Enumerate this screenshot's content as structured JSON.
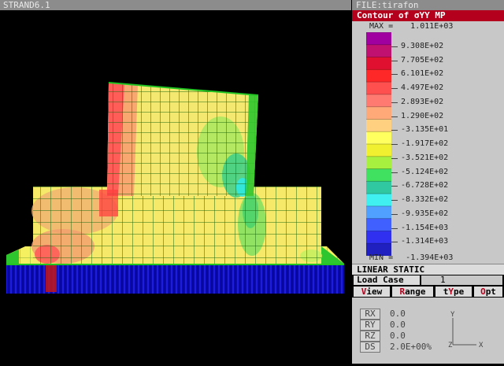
{
  "window": {
    "title": "STRAND6.1"
  },
  "file_bar": {
    "label": "FILE:tirafon"
  },
  "contour": {
    "title": "Contour of σYY MP",
    "max_label": "MAX =",
    "max_value": "1.011E+03",
    "min_label": "MIN =",
    "min_value": "-1.394E+03",
    "levels": [
      "9.308E+02",
      "7.705E+02",
      "6.101E+02",
      "4.497E+02",
      "2.893E+02",
      "1.290E+02",
      "-3.135E+01",
      "-1.917E+02",
      "-3.521E+02",
      "-5.124E+02",
      "-6.728E+02",
      "-8.332E+02",
      "-9.935E+02",
      "-1.154E+03",
      "-1.314E+03"
    ],
    "colors": [
      "#a000a0",
      "#c01070",
      "#e01030",
      "#ff2828",
      "#ff5050",
      "#ff7a70",
      "#ffa878",
      "#ffd080",
      "#ffff60",
      "#f0f030",
      "#a8f040",
      "#40e060",
      "#30c8a0",
      "#40f0f0",
      "#50a0ff",
      "#4060ff",
      "#3030f0",
      "#2020c0"
    ]
  },
  "analysis": {
    "type_label": "LINEAR STATIC"
  },
  "load_case": {
    "label": "Load Case",
    "value": "1"
  },
  "menu": [
    {
      "hotkey": "V",
      "rest": "iew"
    },
    {
      "hotkey": "R",
      "rest": "ange"
    },
    {
      "pre": "t",
      "hotkey": "Y",
      "rest": "pe"
    },
    {
      "hotkey": "O",
      "rest": "pt"
    }
  ],
  "rotation": {
    "rx_label": "RX",
    "rx_value": "0.0",
    "ry_label": "RY",
    "ry_value": "0.0",
    "rz_label": "RZ",
    "rz_value": "0.0",
    "ds_label": "DS",
    "ds_value": "2.0E+00%"
  },
  "axes": {
    "y": "Y",
    "z": "Z",
    "x": "X"
  }
}
